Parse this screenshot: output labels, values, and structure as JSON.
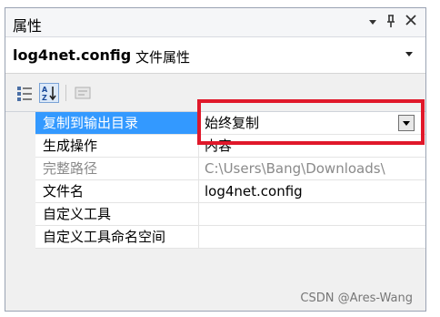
{
  "panel": {
    "title": "属性",
    "titlebar_icons": [
      "dropdown-arrow-icon",
      "pin-icon",
      "close-icon"
    ]
  },
  "selector": {
    "object_name": "log4net.config",
    "object_type": "文件属性"
  },
  "toolbar": {
    "icons": [
      "categorized-icon",
      "alphabetical-icon",
      "property-pages-icon"
    ]
  },
  "properties": [
    {
      "name": "复制到输出目录",
      "value": "始终复制",
      "selected": true,
      "has_dropdown": true
    },
    {
      "name": "生成操作",
      "value": "内容"
    },
    {
      "name": "完整路径",
      "value": "C:\\Users\\Bang\\Downloads\\",
      "readonly": true
    },
    {
      "name": "文件名",
      "value": "log4net.config"
    },
    {
      "name": "自定义工具",
      "value": ""
    },
    {
      "name": "自定义工具命名空间",
      "value": ""
    }
  ],
  "watermark": "CSDN @Ares-Wang",
  "colors": {
    "selection": "#3399ff",
    "highlight_box": "#e0182a"
  }
}
